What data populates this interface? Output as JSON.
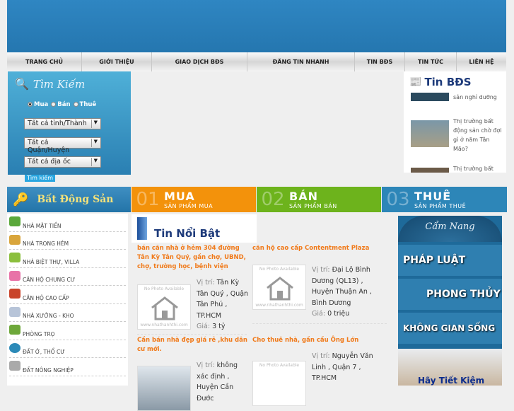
{
  "nav": [
    "TRANG CHỦ",
    "GIỚI THIỆU",
    "GIAO DỊCH BĐS",
    "ĐĂNG TIN NHANH",
    "TIN BĐS",
    "TIN TỨC",
    "LIÊN HỆ"
  ],
  "search": {
    "title": "Tìm Kiếm",
    "radios": [
      "Mua",
      "Bán",
      "Thuê"
    ],
    "selected_radio": "Mua",
    "selects": [
      "Tất cả tỉnh/Thành",
      "Tất cả Quận/Huyện",
      "Tất cả địa ốc"
    ],
    "button": "Tìm kiếm"
  },
  "tinbds": {
    "title": "Tin BĐS",
    "items": [
      "sản nghỉ dưỡng",
      "Thị trường bất động sản chờ đợi gì ở năm Tân Mão?",
      "Thị trường bất"
    ]
  },
  "categories": {
    "left": "Bất Động Sản",
    "tabs": [
      {
        "num": "01",
        "title": "MUA",
        "sub": "SẢN PHẨM MUA",
        "color": "#f3920b"
      },
      {
        "num": "02",
        "title": "BÁN",
        "sub": "SẢN PHẨM BÁN",
        "color": "#6db31c"
      },
      {
        "num": "03",
        "title": "THUÊ",
        "sub": "SẢN PHẨM THUÊ",
        "color": "#2d86b8"
      }
    ]
  },
  "menu": [
    "NHÀ MẶT TIỀN",
    "NHÀ TRONG HẺM",
    "NHÀ BIỆT THỰ, VILLA",
    "CĂN HỘ CHUNG CƯ",
    "CĂN HỘ CAO CẤP",
    "NHÀ XƯỞNG - KHO",
    "PHÒNG TRỌ",
    "ĐẤT Ở, THỔ CƯ",
    "ĐẤT NÔNG NGHIỆP"
  ],
  "featured": {
    "title": "Tin Nổi Bật",
    "photo_text": "No Photo Available",
    "photo_site": "www.nhathanhthi.com",
    "loc_label": "Vị trí:",
    "price_label": "Giá:",
    "listings": [
      {
        "title": "bán căn nhà ở hẻm 304 đường Tân Kỳ Tân Quý, gần chợ, UBND, chợ, trường học, bệnh viện",
        "location": "Tân Kỳ Tân Quý , Quận Tân Phú , TP.HCM",
        "price": "3  tỷ"
      },
      {
        "title": "căn hộ cao cấp Contentment Plaza",
        "location": "Đại Lộ Bình Dương (QL13) , Huyện Thuận An , Bình Dương",
        "price": "0  triệu"
      },
      {
        "title": "Cần bán nhà đẹp giá rẻ ,khu dân cư mới.",
        "location": "không xác định , Huyện Cần Đước",
        "price": ""
      },
      {
        "title": "Cho thuê nhà, gần cầu Ông Lớn",
        "location": "Nguyễn Văn Linh , Quận 7 , TP.HCM",
        "price": ""
      }
    ]
  },
  "camnang": {
    "title": "Cẩm Nang",
    "items": [
      "PHÁP LUẬT",
      "PHONG THỦY",
      "KHÔNG GIAN SỐNG"
    ],
    "ad_text": "Hãy Tiết Kiệm"
  }
}
